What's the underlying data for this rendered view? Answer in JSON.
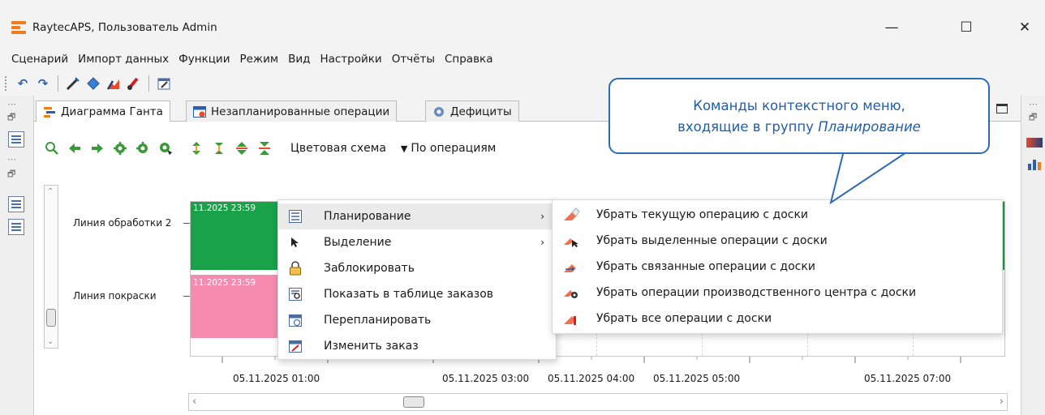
{
  "window": {
    "title": "RaytecAPS, Пользователь Admin",
    "controls": {
      "minimize": "—",
      "maximize": "☐",
      "close": "✕"
    }
  },
  "menubar": {
    "items": [
      "Сценарий",
      "Импорт данных",
      "Функции",
      "Режим",
      "Вид",
      "Настройки",
      "Отчёты",
      "Справка"
    ]
  },
  "tabs": [
    {
      "label": "Диаграмма Ганта",
      "icon": "gantt-icon",
      "active": true
    },
    {
      "label": "Незапланированные операции",
      "icon": "unplanned-ops-icon",
      "active": false
    },
    {
      "label": "Дефициты",
      "icon": "deficits-icon",
      "active": false
    }
  ],
  "gantt_toolbar": {
    "color_scheme_label": "Цветовая схема",
    "color_scheme_value": "По операциям"
  },
  "gantt": {
    "rows": [
      {
        "label": "Линия обработки 2",
        "bar_date": "11.2025 23:59",
        "bar_color": "#19a24a"
      },
      {
        "label": "Линия покраски",
        "bar_date": "11.2025 23:59",
        "bar_color": "#f58bae"
      }
    ],
    "time_labels": [
      "05.11.2025 01:00",
      "05.11.2025 03:00",
      "05.11.2025 04:00",
      "05.11.2025 05:00",
      "05.11.2025 07:00"
    ]
  },
  "context_menu": {
    "items": [
      {
        "label": "Планирование",
        "icon": "planning-icon",
        "submenu": true,
        "highlighted": true
      },
      {
        "label": "Выделение",
        "icon": "cursor-icon",
        "submenu": true,
        "highlighted": false
      },
      {
        "label": "Заблокировать",
        "icon": "lock-icon",
        "submenu": false,
        "highlighted": false
      },
      {
        "label": "Показать в таблице заказов",
        "icon": "table-search-icon",
        "submenu": false,
        "highlighted": false
      },
      {
        "label": "Перепланировать",
        "icon": "calendar-clock-icon",
        "submenu": false,
        "highlighted": false
      },
      {
        "label": "Изменить заказ",
        "icon": "calendar-edit-icon",
        "submenu": false,
        "highlighted": false
      }
    ],
    "submenu_arrow": "›"
  },
  "submenu": {
    "items": [
      {
        "label": "Убрать текущую операцию с доски",
        "icon": "eraser-icon"
      },
      {
        "label": "Убрать выделенные операции с доски",
        "icon": "eraser-cursor-icon"
      },
      {
        "label": "Убрать связанные операции с доски",
        "icon": "eraser-linked-icon"
      },
      {
        "label": "Убрать операции производственного центра с доски",
        "icon": "eraser-gear-icon"
      },
      {
        "label": "Убрать все операции с доски",
        "icon": "eraser-all-icon"
      }
    ]
  },
  "callout": {
    "line1": "Команды контекстного меню,",
    "line2_prefix": "входящие в группу ",
    "line2_emphasis": "Планирование"
  },
  "colors": {
    "accent_blue": "#2b6cb4",
    "callout_text": "#1f5ea8",
    "bar_green": "#19a24a",
    "bar_pink": "#f58bae"
  }
}
